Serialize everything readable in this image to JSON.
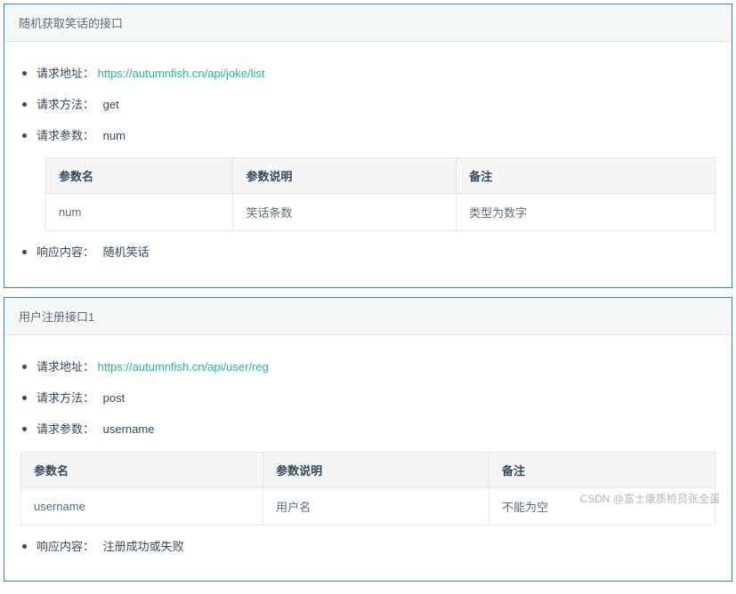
{
  "watermark": "CSDN @富士康质检员张全蛋",
  "labels": {
    "req_url": "请求地址：",
    "req_method": "请求方法：",
    "req_params": "请求参数：",
    "resp_body": "响应内容：",
    "col_name": "参数名",
    "col_desc": "参数说明",
    "col_note": "备注"
  },
  "panels": [
    {
      "title": "随机获取笑话的接口",
      "url": "https://autumnfish.cn/api/joke/list",
      "method": "get",
      "params_summary": "num",
      "resp": "随机笑话",
      "table_indent": true,
      "rows": [
        {
          "name": "num",
          "desc": "笑话条数",
          "note": "类型为数字"
        }
      ]
    },
    {
      "title": "用户注册接口1",
      "url": "https://autumnfish.cn/api/user/reg",
      "method": "post",
      "params_summary": "username",
      "resp": "注册成功或失败",
      "table_indent": false,
      "rows": [
        {
          "name": "username",
          "desc": "用户名",
          "note": "不能为空"
        }
      ]
    }
  ]
}
